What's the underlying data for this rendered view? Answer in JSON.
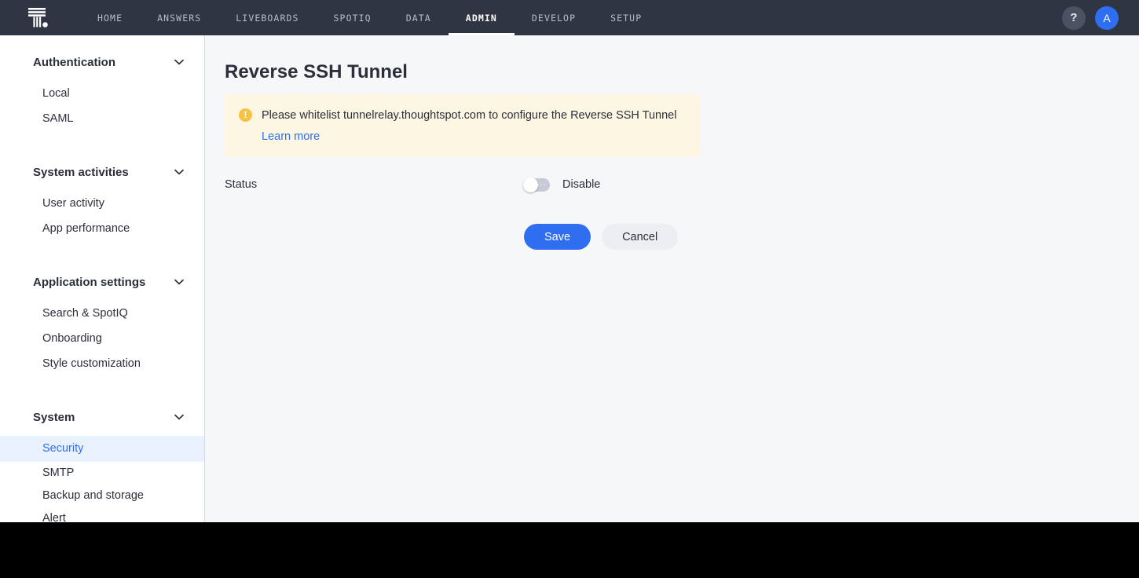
{
  "topbar": {
    "logo_name": "thoughtspot-logo",
    "nav_items": [
      {
        "label": "HOME",
        "active": false
      },
      {
        "label": "ANSWERS",
        "active": false
      },
      {
        "label": "LIVEBOARDS",
        "active": false
      },
      {
        "label": "SPOTIQ",
        "active": false
      },
      {
        "label": "DATA",
        "active": false
      },
      {
        "label": "ADMIN",
        "active": true
      },
      {
        "label": "DEVELOP",
        "active": false
      },
      {
        "label": "SETUP",
        "active": false
      }
    ],
    "help_label": "?",
    "avatar_label": "A",
    "accent_color": "#2f6ef0",
    "bar_color": "#2f3542"
  },
  "sidebar": {
    "groups": [
      {
        "title": "Authentication",
        "items": [
          {
            "label": "Local",
            "active": false
          },
          {
            "label": "SAML",
            "active": false
          }
        ]
      },
      {
        "title": "System activities",
        "items": [
          {
            "label": "User activity",
            "active": false
          },
          {
            "label": "App performance",
            "active": false
          }
        ]
      },
      {
        "title": "Application settings",
        "items": [
          {
            "label": "Search & SpotIQ",
            "active": false
          },
          {
            "label": "Onboarding",
            "active": false
          },
          {
            "label": "Style customization",
            "active": false
          }
        ]
      },
      {
        "title": "System",
        "items": [
          {
            "label": "Security",
            "active": true
          },
          {
            "label": "SMTP",
            "active": false
          },
          {
            "label": "Backup and storage",
            "active": false
          },
          {
            "label": "Alert",
            "active": false
          }
        ]
      }
    ],
    "active_item_color": "#2f6ef0",
    "active_item_background": "#e9f1fd"
  },
  "main": {
    "title": "Reverse SSH Tunnel",
    "warning": {
      "icon": "warning-exclamation-icon",
      "message": "Please whitelist tunnelrelay.thoughtspot.com to configure the Reverse SSH Tunnel",
      "link_label": "Learn more",
      "background": "#fdf6e3",
      "icon_color": "#f6c243"
    },
    "status": {
      "label": "Status",
      "toggle_state_label": "Disable",
      "toggle_on": false
    },
    "buttons": {
      "save_label": "Save",
      "cancel_label": "Cancel"
    }
  }
}
